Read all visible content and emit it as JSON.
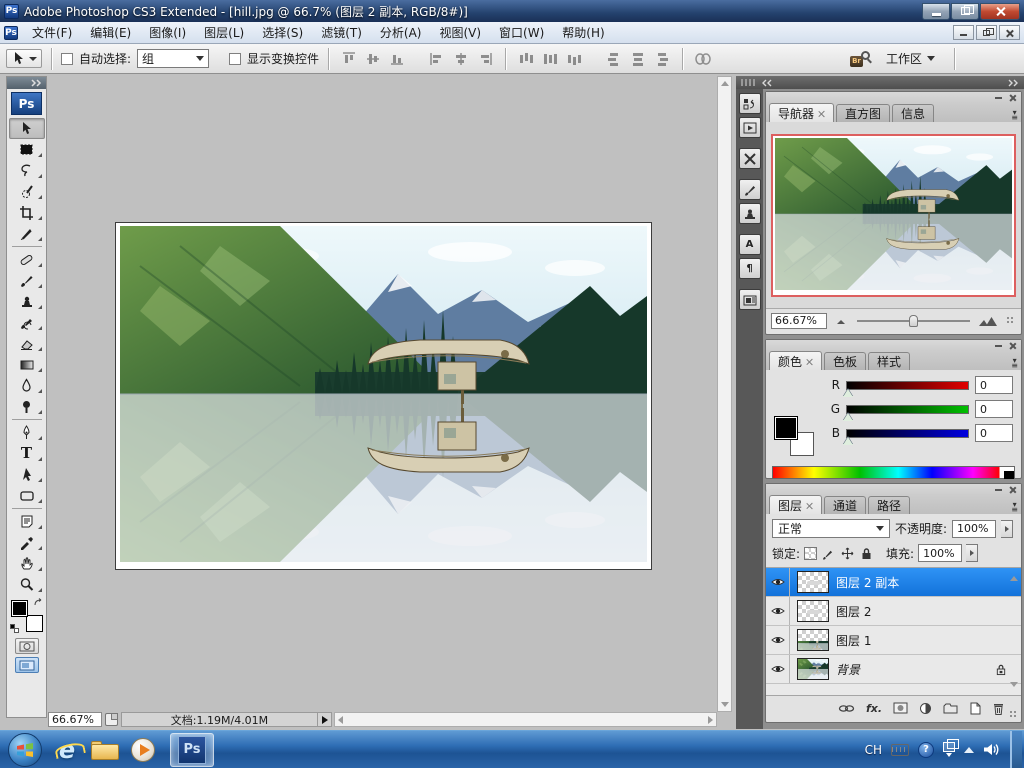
{
  "window": {
    "title": "Adobe Photoshop CS3 Extended - [hill.jpg @ 66.7% (图层 2 副本, RGB/8#)]"
  },
  "branding": {
    "ps_logo": "Ps"
  },
  "menu_bar": {
    "items": [
      "文件(F)",
      "编辑(E)",
      "图像(I)",
      "图层(L)",
      "选择(S)",
      "滤镜(T)",
      "分析(A)",
      "视图(V)",
      "窗口(W)",
      "帮助(H)"
    ]
  },
  "options_bar": {
    "auto_select_label": "自动选择:",
    "auto_select_value": "组",
    "show_transform_label": "显示变换控件",
    "bridge_glyph": "Br",
    "workspace_label": "工作区"
  },
  "toolbox": {
    "type_tool_glyph": "T",
    "tools": [
      "move",
      "rectangular-marquee",
      "lasso",
      "quick-selection",
      "crop",
      "slice",
      "healing-brush",
      "brush",
      "clone-stamp",
      "history-brush",
      "eraser",
      "gradient",
      "blur",
      "dodge",
      "pen",
      "type",
      "path-selection",
      "shape",
      "notes",
      "eyedropper",
      "hand",
      "zoom"
    ]
  },
  "dock": {
    "character_glyph": "A",
    "paragraph_glyph": "¶"
  },
  "panels": {
    "navigator": {
      "tabs": [
        "导航器",
        "直方图",
        "信息"
      ],
      "zoom_value": "66.67%"
    },
    "color": {
      "tabs": [
        "颜色",
        "色板",
        "样式"
      ],
      "channels": [
        {
          "label": "R",
          "value": "0"
        },
        {
          "label": "G",
          "value": "0"
        },
        {
          "label": "B",
          "value": "0"
        }
      ]
    },
    "layers": {
      "tabs": [
        "图层",
        "通道",
        "路径"
      ],
      "blend_mode": "正常",
      "opacity_label": "不透明度:",
      "opacity_value": "100%",
      "lock_label": "锁定:",
      "fill_label": "填充:",
      "fill_value": "100%",
      "rows": [
        {
          "name": "图层 2 副本"
        },
        {
          "name": "图层 2"
        },
        {
          "name": "图层 1"
        },
        {
          "name": "背景"
        }
      ],
      "footer_fx": "fx."
    }
  },
  "status_bar": {
    "zoom": "66.67%",
    "doc_info": "文档:1.19M/4.01M"
  },
  "taskbar": {
    "language": "CH",
    "ie_glyph": "e",
    "help_glyph": "?"
  },
  "colors": {
    "selection_blue": "#1e82ea",
    "navigator_border": "#dd5f5f",
    "titlebar_blue": "#24426e",
    "taskbar_blue": "#2e6db4",
    "foreground_color": "#000000",
    "background_color": "#ffffff"
  }
}
